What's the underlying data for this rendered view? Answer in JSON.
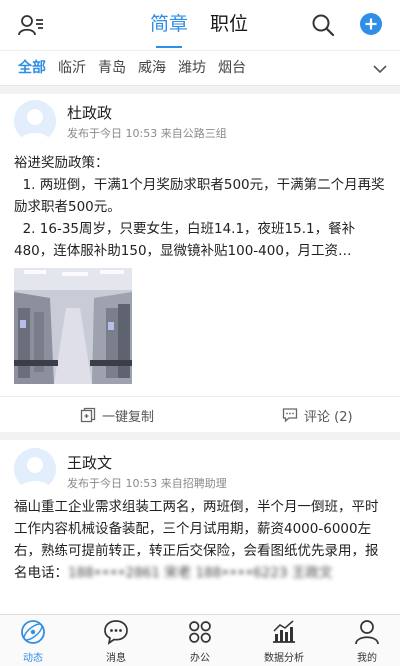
{
  "header": {
    "tabs": [
      {
        "label": "简章",
        "active": true
      },
      {
        "label": "职位",
        "active": false
      }
    ]
  },
  "cities": [
    {
      "label": "全部",
      "active": true
    },
    {
      "label": "临沂"
    },
    {
      "label": "青岛"
    },
    {
      "label": "威海"
    },
    {
      "label": "潍坊"
    },
    {
      "label": "烟台"
    }
  ],
  "posts": [
    {
      "name": "杜政政",
      "meta": "发布于今日 10:53   来自公路三组",
      "body": [
        "裕进奖励政策：",
        "  1. 两班倒，干满1个月奖励求职者500元，干满第二个月再奖励求职者500元。",
        "  2. 16-35周岁，只要女生，白班14.1，夜班15.1，餐补480，连体服补助150，显微镜补贴100-400，月工资…"
      ],
      "copy_label": "一键复制",
      "comment_label": "评论 (2)"
    },
    {
      "name": "王政文",
      "meta": "发布于今日 10:53   来自招聘助理",
      "body": "福山重工企业需求组装工两名，两班倒，半个月一倒班，平时工作内容机械设备装配，三个月试用期，薪资4000-6000左右，熟练可提前转正，转正后交保险，会看图纸优先录用，报名电话：",
      "blurred": "188••••2861 宋老 188••••6223 王政文"
    }
  ],
  "bottom_nav": [
    {
      "label": "动态",
      "active": true
    },
    {
      "label": "消息"
    },
    {
      "label": "办公"
    },
    {
      "label": "数据分析"
    },
    {
      "label": "我的"
    }
  ],
  "colors": {
    "accent": "#2f8ee6",
    "text": "#222222",
    "muted": "#8a8a8a"
  }
}
